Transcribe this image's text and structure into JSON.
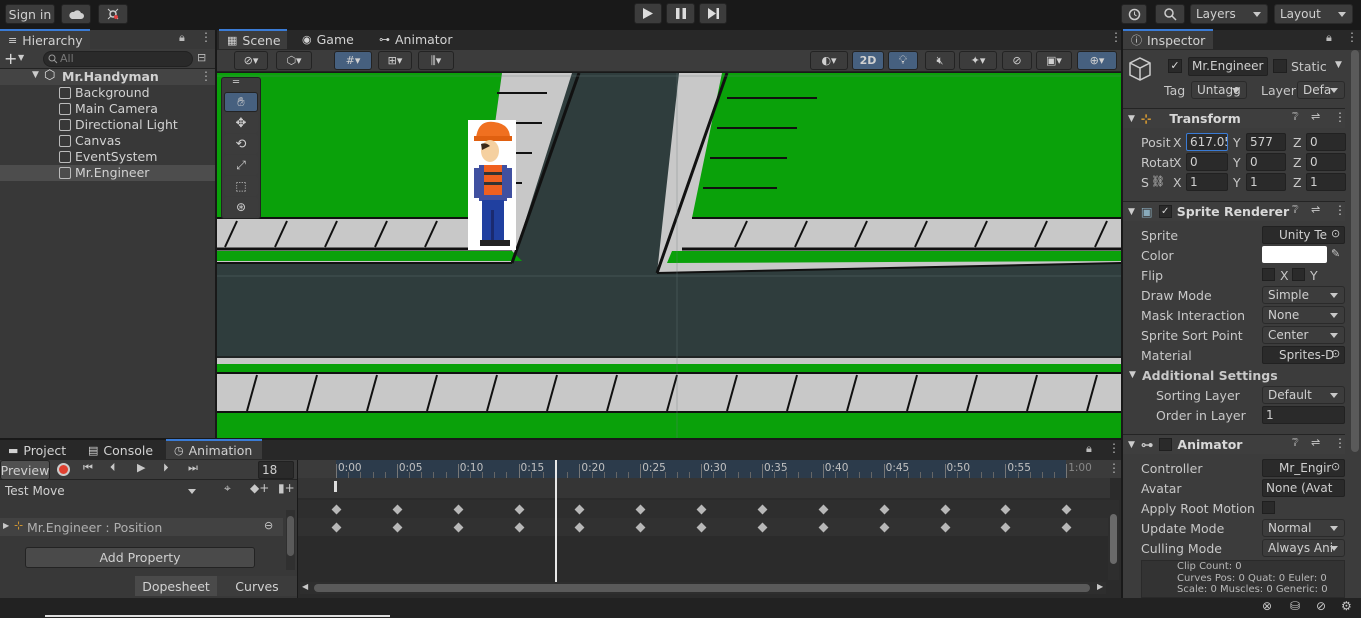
{
  "toolbar": {
    "sign_in": "Sign in",
    "layers": "Layers",
    "layout": "Layout"
  },
  "hierarchy": {
    "tab": "Hierarchy",
    "search_placeholder": "All",
    "scene": "Mr.Handyman",
    "items": [
      "Background",
      "Main Camera",
      "Directional Light",
      "Canvas",
      "EventSystem",
      "Mr.Engineer"
    ],
    "selected": "Mr.Engineer"
  },
  "scene_tabs": {
    "scene": "Scene",
    "game": "Game",
    "animator": "Animator",
    "mode_2d": "2D"
  },
  "inspector": {
    "tab": "Inspector",
    "object_name": "Mr.Engineer",
    "static_label": "Static",
    "tag_label": "Tag",
    "tag_value": "Untagg",
    "layer_label": "Layer",
    "layer_value": "Defa",
    "transform": {
      "title": "Transform",
      "pos_label": "Posit",
      "rot_label": "Rotat",
      "scale_label": "S",
      "px": "617.05",
      "py": "577",
      "pz": "0",
      "rx": "0",
      "ry": "0",
      "rz": "0",
      "sx": "1",
      "sy": "1",
      "sz": "1",
      "x": "X",
      "y": "Y",
      "z": "Z"
    },
    "sprite_renderer": {
      "title": "Sprite Renderer",
      "sprite_label": "Sprite",
      "sprite_value": "Unity Te",
      "color_label": "Color",
      "color_value": "#ffffff",
      "flip_label": "Flip",
      "flip_x": "X",
      "flip_y": "Y",
      "draw_mode_label": "Draw Mode",
      "draw_mode_value": "Simple",
      "mask_label": "Mask Interaction",
      "mask_value": "None",
      "sort_point_label": "Sprite Sort Point",
      "sort_point_value": "Center",
      "material_label": "Material",
      "material_value": "Sprites-D",
      "additional": "Additional Settings",
      "sorting_layer_label": "Sorting Layer",
      "sorting_layer_value": "Default",
      "order_label": "Order in Layer",
      "order_value": "1"
    },
    "animator": {
      "title": "Animator",
      "controller_label": "Controller",
      "controller_value": "Mr_Engir",
      "avatar_label": "Avatar",
      "avatar_value": "None (Avat",
      "root_motion_label": "Apply Root Motion",
      "update_mode_label": "Update Mode",
      "update_mode_value": "Normal",
      "culling_label": "Culling Mode",
      "culling_value": "Always Ani",
      "info": [
        "Clip Count: 0",
        "Curves Pos: 0 Quat: 0 Euler: 0",
        "Scale: 0 Muscles: 0 Generic: 0"
      ]
    }
  },
  "bottom_tabs": {
    "project": "Project",
    "console": "Console",
    "animation": "Animation"
  },
  "animation": {
    "preview": "Preview",
    "frame": "18",
    "clip": "Test Move",
    "property": "Mr.Engineer : Position",
    "add_property": "Add Property",
    "dopesheet": "Dopesheet",
    "curves": "Curves",
    "ticks": [
      "0:00",
      "0:05",
      "0:10",
      "0:15",
      "0:20",
      "0:25",
      "0:30",
      "0:35",
      "0:40",
      "0:45",
      "0:50",
      "0:55",
      "1:00"
    ],
    "keyframe_times": [
      0,
      5,
      10,
      15,
      20,
      25,
      30,
      35,
      40,
      45,
      50,
      55,
      60
    ],
    "playhead_time": 18
  },
  "colors": {
    "accent": "#3a7bd5",
    "grass": "#0aa10a",
    "road": "#303d3d",
    "sidewalk": "#c8c8c8"
  }
}
